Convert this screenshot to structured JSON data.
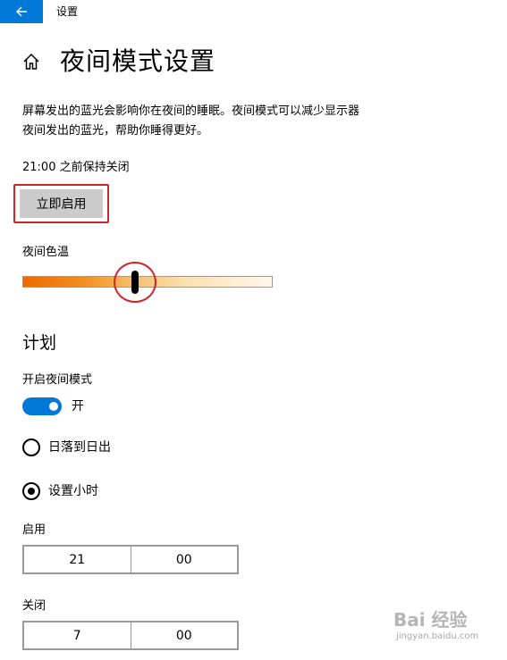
{
  "app": {
    "title": "设置"
  },
  "page": {
    "title": "夜间模式设置"
  },
  "description": {
    "line1": "屏幕发出的蓝光会影响你在夜间的睡眠。夜间模式可以减少显示器",
    "line2": "夜间发出的蓝光，帮助你睡得更好。"
  },
  "status": "21:00 之前保持关闭",
  "enable_now_button": "立即启用",
  "color_temperature": {
    "label": "夜间色温",
    "value_fraction": 0.45
  },
  "schedule": {
    "section_title": "计划",
    "toggle_label": "开启夜间模式",
    "toggle_state": "开",
    "toggle_on": true,
    "options": [
      {
        "label": "日落到日出",
        "selected": false
      },
      {
        "label": "设置小时",
        "selected": true
      }
    ],
    "on_time": {
      "label": "启用",
      "hour": "21",
      "minute": "00"
    },
    "off_time": {
      "label": "关闭",
      "hour": "7",
      "minute": "00"
    }
  },
  "watermark": {
    "text": "Bai 经验",
    "url": "jingyan.baidu.com"
  },
  "colors": {
    "accent": "#0078d7",
    "highlight": "#d2232a",
    "button_bg": "#cccccc"
  },
  "icons": {
    "back": "back-arrow-icon",
    "home": "home-icon"
  }
}
